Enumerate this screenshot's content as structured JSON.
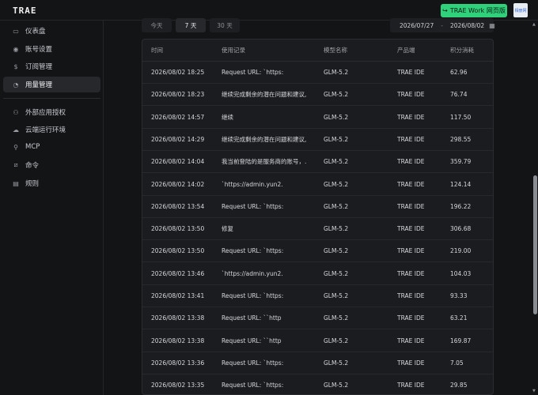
{
  "header": {
    "logo": "TRAE",
    "web_button_label": "TRAE Work 网页版",
    "avatar_text": "相册网"
  },
  "sidebar": {
    "items": [
      {
        "label": "仪表盘",
        "icon": "monitor-icon"
      },
      {
        "label": "账号设置",
        "icon": "user-circle-icon"
      },
      {
        "label": "订阅管理",
        "icon": "dollar-circle-icon"
      },
      {
        "label": "用量管理",
        "icon": "gauge-icon",
        "active": true
      },
      {
        "label": "外部应用授权",
        "icon": "people-icon"
      },
      {
        "label": "云端运行环境",
        "icon": "cloud-icon"
      },
      {
        "label": "MCP",
        "icon": "plug-icon"
      },
      {
        "label": "命令",
        "icon": "command-icon"
      },
      {
        "label": "规则",
        "icon": "document-icon"
      }
    ]
  },
  "filters": {
    "ranges": [
      "今天",
      "7 天",
      "30 天"
    ],
    "active_range": "7 天",
    "start_date": "2026/07/27",
    "separator": "-",
    "end_date": "2026/08/02"
  },
  "table": {
    "columns": [
      "时间",
      "使用记录",
      "模型名称",
      "产品端",
      "积分消耗"
    ],
    "rows": [
      [
        "2026/08/02 18:25",
        "Request URL: `https:",
        "GLM-5.2",
        "TRAE IDE",
        "62.96"
      ],
      [
        "2026/08/02 18:23",
        "继续完成剩余的潜在问题和建议,...",
        "GLM-5.2",
        "TRAE IDE",
        "76.74"
      ],
      [
        "2026/08/02 14:57",
        "继续",
        "GLM-5.2",
        "TRAE IDE",
        "117.50"
      ],
      [
        "2026/08/02 14:29",
        "继续完成剩余的潜在问题和建议,...",
        "GLM-5.2",
        "TRAE IDE",
        "298.55"
      ],
      [
        "2026/08/02 14:04",
        "我当前登陆的是服务商的账号，...",
        "GLM-5.2",
        "TRAE IDE",
        "359.79"
      ],
      [
        "2026/08/02 14:02",
        "`https://admin.yun2.",
        "GLM-5.2",
        "TRAE IDE",
        "124.14"
      ],
      [
        "2026/08/02 13:54",
        "Request URL: `https:",
        "GLM-5.2",
        "TRAE IDE",
        "196.22"
      ],
      [
        "2026/08/02 13:50",
        "修复",
        "GLM-5.2",
        "TRAE IDE",
        "306.68"
      ],
      [
        "2026/08/02 13:50",
        "Request URL: `https:",
        "GLM-5.2",
        "TRAE IDE",
        "219.00"
      ],
      [
        "2026/08/02 13:46",
        "`https://admin.yun2.",
        "GLM-5.2",
        "TRAE IDE",
        "104.03"
      ],
      [
        "2026/08/02 13:41",
        "Request URL: `https:",
        "GLM-5.2",
        "TRAE IDE",
        "93.33"
      ],
      [
        "2026/08/02 13:38",
        "Request URL: ``http",
        "GLM-5.2",
        "TRAE IDE",
        "63.21"
      ],
      [
        "2026/08/02 13:38",
        "Request URL: ``http",
        "GLM-5.2",
        "TRAE IDE",
        "169.87"
      ],
      [
        "2026/08/02 13:36",
        "Request URL: `https:",
        "GLM-5.2",
        "TRAE IDE",
        "7.05"
      ],
      [
        "2026/08/02 13:35",
        "Request URL: `https:",
        "GLM-5.2",
        "TRAE IDE",
        "29.85"
      ]
    ]
  },
  "colors": {
    "accent": "#2fd27a",
    "background": "#131416",
    "table_bg": "#1b1c1f"
  }
}
